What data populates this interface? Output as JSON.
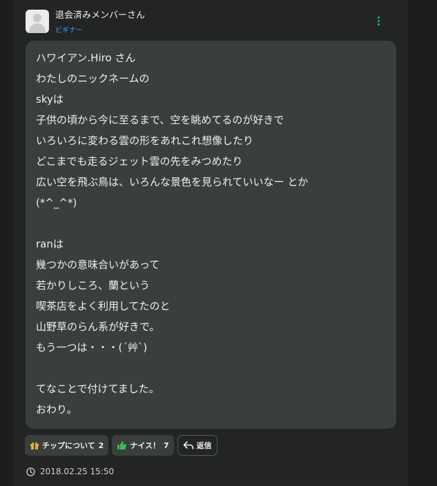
{
  "post": {
    "username": "退会済みメンバーさん",
    "rank": "ビギナー",
    "lines": [
      "ハワイアン.Hiro さん",
      "わたしのニックネームの",
      "skyは",
      "子供の頃から今に至るまで、空を眺めてるのが好きで",
      "いろいろに変わる雲の形をあれこれ想像したり",
      "どこまでも走るジェット雲の先をみつめたり",
      "広い空を飛ぶ鳥は、いろんな景色を見られていいなー とか",
      "(*^_^*)",
      "",
      "ranは",
      "幾つかの意味合いがあって",
      "若かりしころ、蘭という",
      "喫茶店をよく利用してたのと",
      "山野草のらん系が好きで。",
      "もう一つは・・・(´艸`)",
      "",
      "てなことで付けてました。",
      "おわり。"
    ],
    "date": "2018.02.25 15:50"
  },
  "actions": {
    "tip_label": "チップについて",
    "tip_count": "2",
    "nice_label": "ナイス！",
    "nice_count": "7",
    "reply_label": "返信"
  },
  "icons": {
    "menu": "kebab-menu-icon",
    "tip": "gift-icon",
    "nice": "thumbs-up-icon",
    "reply": "reply-arrow-icon",
    "clock": "clock-icon"
  },
  "colors": {
    "rank": "#2ea3f2",
    "menu_dots": "#2fb36a",
    "gift": "#e0b43a",
    "thumb": "#3fb867",
    "bubble": "#3a3f3c"
  }
}
